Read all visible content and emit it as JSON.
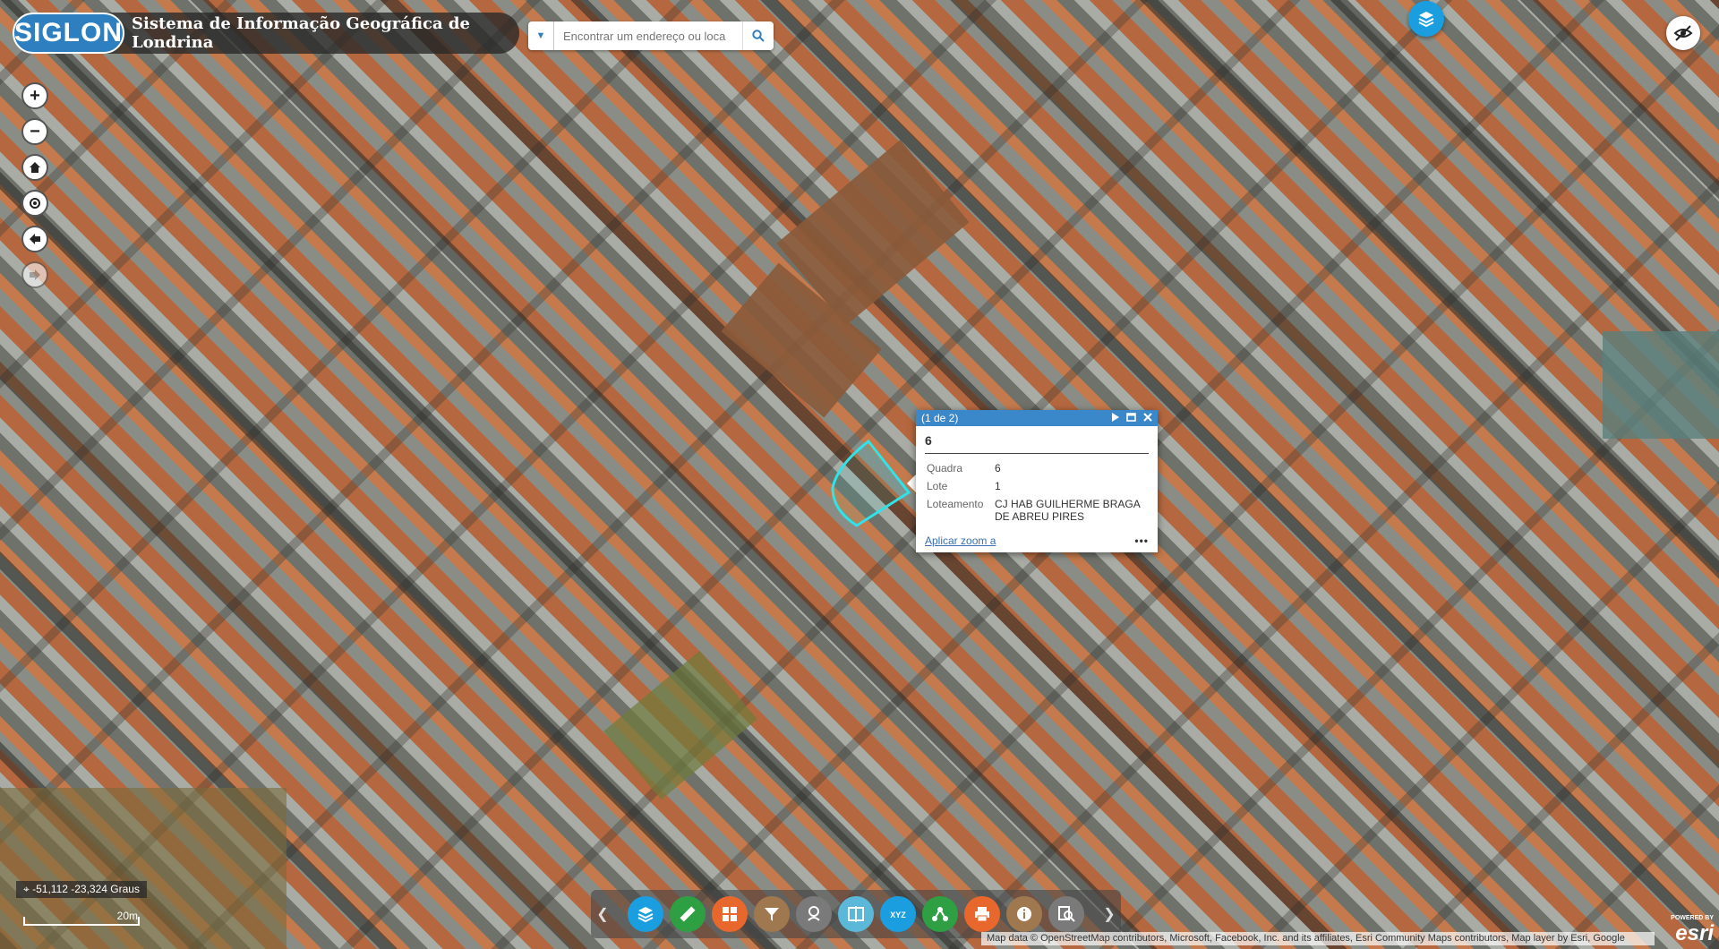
{
  "header": {
    "logo_text": "SIGLON",
    "title": "Sistema de Informação Geográfica de Londrina"
  },
  "search": {
    "placeholder": "Encontrar um endereço ou loca"
  },
  "map_controls": {
    "zoom_in": "+",
    "zoom_out": "−"
  },
  "popup": {
    "header": "(1 de 2)",
    "title": "6",
    "rows": [
      {
        "label": "Quadra",
        "value": "6"
      },
      {
        "label": "Lote",
        "value": "1"
      },
      {
        "label": "Loteamento",
        "value": "CJ HAB GUILHERME BRAGA DE ABREU PIRES"
      }
    ],
    "zoom_link": "Aplicar zoom a",
    "more": "•••"
  },
  "coordinates": "-51,112 -23,324 Graus",
  "scale": "20m",
  "toolbar": {
    "buttons": [
      {
        "name": "layers-tool",
        "color": "#1a9ee0",
        "icon": "layers-icon"
      },
      {
        "name": "measure-tool",
        "color": "#2ea043",
        "icon": "ruler-icon"
      },
      {
        "name": "basemap-tool",
        "color": "#e8672c",
        "icon": "grid-icon"
      },
      {
        "name": "filter-tool",
        "color": "#a07850",
        "icon": "funnel-icon"
      },
      {
        "name": "draw-tool",
        "color": "#7a7a7a",
        "icon": "draw-icon"
      },
      {
        "name": "swipe-tool",
        "color": "#5bb8d8",
        "icon": "swipe-icon"
      },
      {
        "name": "xyz-tool",
        "color": "#1a9ee0",
        "icon": "xyz-icon"
      },
      {
        "name": "share-tool",
        "color": "#2ea043",
        "icon": "share-icon"
      },
      {
        "name": "print-tool",
        "color": "#e8672c",
        "icon": "print-icon"
      },
      {
        "name": "info-tool",
        "color": "#a07850",
        "icon": "info-icon"
      },
      {
        "name": "query-tool",
        "color": "#7a7a7a",
        "icon": "query-icon"
      }
    ]
  },
  "attribution": "Map data © OpenStreetMap contributors, Microsoft, Facebook, Inc. and its affiliates, Esri Community Maps contributors, Map layer by Esri, Google",
  "esri": {
    "powered_by": "POWERED BY",
    "logo": "esri"
  }
}
